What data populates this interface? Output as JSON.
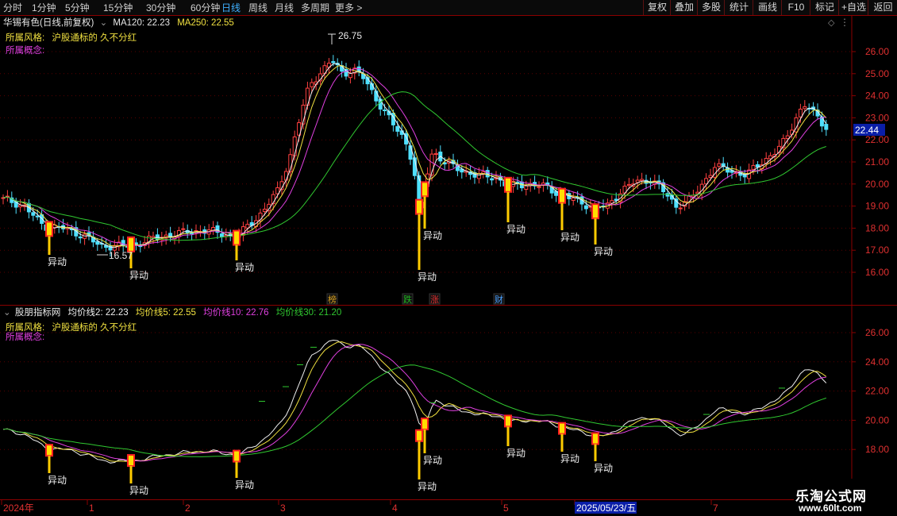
{
  "toolbar": {
    "periods": [
      {
        "label": "分时",
        "active": false
      },
      {
        "label": "1分钟",
        "active": false
      },
      {
        "label": "5分钟",
        "active": false
      },
      {
        "label": "15分钟",
        "active": false
      },
      {
        "label": "30分钟",
        "active": false
      },
      {
        "label": "60分钟",
        "active": false
      },
      {
        "label": "日线",
        "active": true
      },
      {
        "label": "周线",
        "active": false
      },
      {
        "label": "月线",
        "active": false
      },
      {
        "label": "多周期",
        "active": false
      },
      {
        "label": "更多 >",
        "active": false
      }
    ],
    "actions": [
      "复权",
      "叠加",
      "多股",
      "统计",
      "画线",
      "F10",
      "标记",
      "+自选",
      "返回"
    ]
  },
  "main_panel": {
    "stock_title": "华锡有色(日线,前复权)",
    "ma120_label": "MA120: 22.23",
    "ma250_label": "MA250: 22.55",
    "style_label": "所属风格:",
    "style_value": "沪股通标的 久不分红",
    "concept_label": "所属概念:",
    "high_marker": "26.75",
    "low_marker": "16.57",
    "current_price": "22.44",
    "y_ticks": [
      "26.00",
      "25.00",
      "24.00",
      "23.00",
      "22.00",
      "21.00",
      "20.00",
      "19.00",
      "18.00",
      "17.00",
      "16.00"
    ],
    "event_tags": [
      {
        "text": "榜",
        "color": "#d8a020"
      },
      {
        "text": "跌",
        "color": "#22b522"
      },
      {
        "text": "涨",
        "color": "#e03030"
      },
      {
        "text": "财",
        "color": "#4aa0ff"
      }
    ],
    "signal_label": "异动",
    "colors": {
      "up": "#ff4040",
      "down": "#4fe0ff",
      "ma_white": "#f0f0f0",
      "ma_yellow": "#f0e040",
      "ma_magenta": "#e040e0",
      "ma_green": "#30c830",
      "signal": "#ffcc00"
    }
  },
  "indicator_panel": {
    "title": "股朋指标网",
    "line2_label": "均价线2: 22.23",
    "line5_label": "均价线5: 22.55",
    "line10_label": "均价线10: 22.76",
    "line30_label": "均价线30: 21.20",
    "style_label": "所属风格:",
    "style_value": "沪股通标的 久不分红",
    "concept_label": "所属概念:",
    "y_ticks": [
      "26.00",
      "24.00",
      "22.00",
      "20.00",
      "18.00"
    ],
    "signal_label": "异动"
  },
  "time_axis": {
    "labels": [
      "2024年",
      "1",
      "2",
      "3",
      "4",
      "5",
      "2025/05/23/五",
      "7"
    ],
    "highlight": "2025/05/23/五"
  },
  "watermark": {
    "title": "乐淘公式网",
    "url": "www.60lt.com"
  }
}
